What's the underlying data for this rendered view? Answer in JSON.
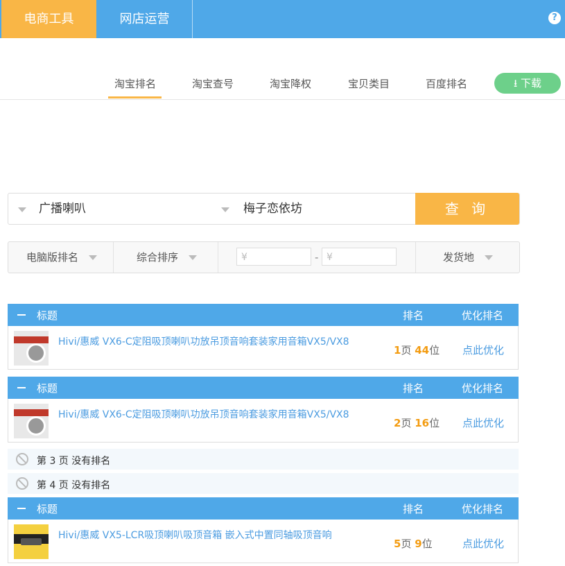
{
  "top_tabs": [
    "电商工具",
    "网店运营"
  ],
  "help_label": "?",
  "sub_tabs": [
    "淘宝排名",
    "淘宝查号",
    "淘宝降权",
    "宝贝类目",
    "百度排名"
  ],
  "download_label": "下载",
  "search": {
    "keyword": "广播喇叭",
    "shop": "梅子恋依坊",
    "button": "查 询"
  },
  "filters": {
    "platform": "电脑版排名",
    "sort": "综合排序",
    "price_symbol": "¥",
    "price_sep": "-",
    "location": "发货地"
  },
  "header": {
    "title": "标题",
    "rank": "排名",
    "optimize": "优化排名"
  },
  "results": [
    {
      "title": "Hivi/惠威 VX6-C定阻吸顶喇叭功放吊顶音响套装家用音箱VX5/VX8",
      "page": "1",
      "pos": "44",
      "page_unit": "页",
      "pos_unit": "位",
      "action": "点此优化"
    },
    {
      "title": "Hivi/惠威 VX6-C定阻吸顶喇叭功放吊顶音响套装家用音箱VX5/VX8",
      "page": "2",
      "pos": "16",
      "page_unit": "页",
      "pos_unit": "位",
      "action": "点此优化"
    },
    {
      "title": "Hivi/惠威 VX5-LCR吸顶喇叭吸顶音箱 嵌入式中置同轴吸顶音响",
      "page": "5",
      "pos": "9",
      "page_unit": "页",
      "pos_unit": "位",
      "action": "点此优化"
    }
  ],
  "no_rank": [
    "第 3 页 没有排名",
    "第 4 页 没有排名"
  ]
}
